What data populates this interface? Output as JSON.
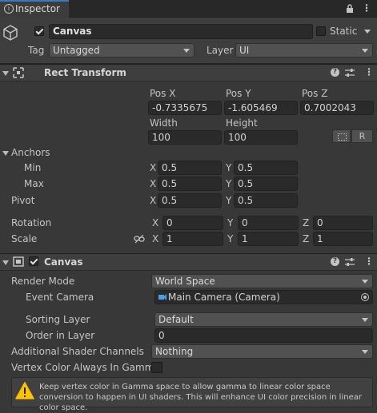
{
  "tab": {
    "title": "Inspector"
  },
  "object": {
    "name": "Canvas",
    "static_label": "Static",
    "tag_label": "Tag",
    "tag_value": "Untagged",
    "layer_label": "Layer",
    "layer_value": "UI"
  },
  "rect_transform": {
    "title": "Rect Transform",
    "pos_x_label": "Pos X",
    "pos_y_label": "Pos Y",
    "pos_z_label": "Pos Z",
    "pos_x": "-0.7335675",
    "pos_y": "-1.605469",
    "pos_z": "0.7002043",
    "width_label": "Width",
    "height_label": "Height",
    "width": "100",
    "height": "100",
    "r_label": "R",
    "anchors_label": "Anchors",
    "min_label": "Min",
    "max_label": "Max",
    "pivot_label": "Pivot",
    "min_x": "0.5",
    "min_y": "0.5",
    "max_x": "0.5",
    "max_y": "0.5",
    "pivot_x": "0.5",
    "pivot_y": "0.5",
    "rotation_label": "Rotation",
    "scale_label": "Scale",
    "rot_x": "0",
    "rot_y": "0",
    "rot_z": "0",
    "scale_x": "1",
    "scale_y": "1",
    "scale_z": "1",
    "axis_x": "X",
    "axis_y": "Y",
    "axis_z": "Z"
  },
  "canvas": {
    "title": "Canvas",
    "render_mode_label": "Render Mode",
    "render_mode": "World Space",
    "event_camera_label": "Event Camera",
    "event_camera": "Main Camera (Camera)",
    "sorting_layer_label": "Sorting Layer",
    "sorting_layer": "Default",
    "order_label": "Order in Layer",
    "order": "0",
    "shader_channels_label": "Additional Shader Channels",
    "shader_channels": "Nothing",
    "vertex_color_label": "Vertex Color Always In Gamma",
    "warning": "Keep vertex color in Gamma space to allow gamma to linear color space conversion to happen in UI shaders. This will enhance UI color precision in linear color space."
  }
}
